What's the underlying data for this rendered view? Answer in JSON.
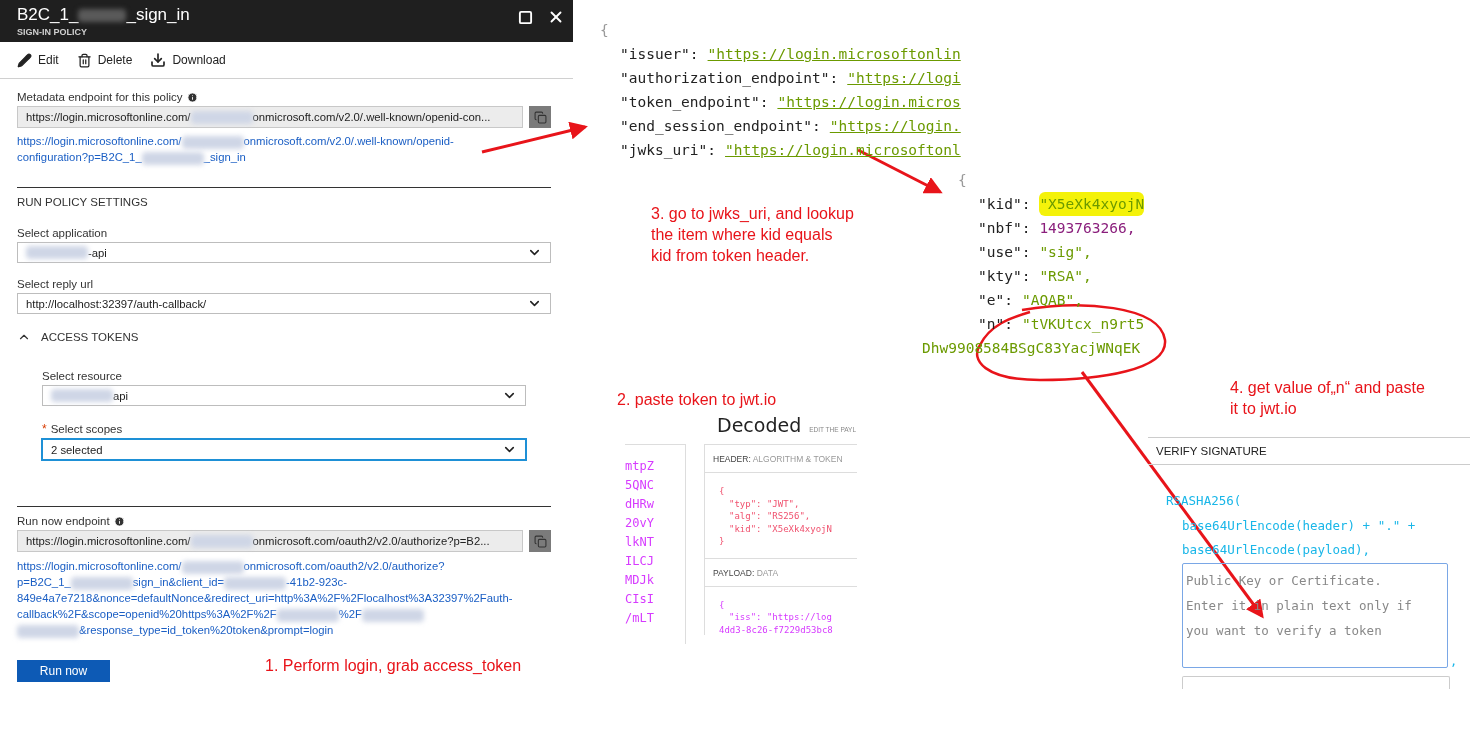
{
  "policy_blade": {
    "title": [
      {
        "kind": "text",
        "text": "B2C_1_"
      },
      {
        "kind": "redacted"
      },
      {
        "kind": "text",
        "text": "_sign_in"
      }
    ],
    "subtitle": "SIGN-IN POLICY",
    "toolbar": [
      {
        "kind": "edit",
        "label": "Edit"
      },
      {
        "kind": "delete",
        "label": "Delete"
      },
      {
        "kind": "download",
        "label": "Download"
      }
    ],
    "metadata": {
      "label": "Metadata endpoint for this policy",
      "value": [
        {
          "kind": "text",
          "text": "https://login.microsoftonline.com/"
        },
        {
          "kind": "redacted"
        },
        {
          "kind": "text",
          "text": "onmicrosoft.com/v2.0/.well-known/openid-con..."
        }
      ],
      "link_lines": [
        [
          {
            "kind": "text",
            "text": "https://login.microsoftonline.com/"
          },
          {
            "kind": "redacted"
          },
          {
            "kind": "text",
            "text": "onmicrosoft.com/v2.0/.well-known/openid-"
          }
        ],
        [
          {
            "kind": "text",
            "text": "configuration?p=B2C_1_"
          },
          {
            "kind": "redacted"
          },
          {
            "kind": "text",
            "text": "_sign_in"
          }
        ]
      ]
    },
    "run_policy_settings": {
      "heading": "RUN POLICY SETTINGS",
      "application": {
        "label": "Select application",
        "value": [
          {
            "kind": "redacted"
          },
          {
            "kind": "text",
            "text": "-api"
          }
        ]
      },
      "reply_url": {
        "label": "Select reply url",
        "value": [
          {
            "kind": "text",
            "text": "http://localhost:32397/auth-callback/"
          }
        ]
      },
      "access_tokens": {
        "heading": "ACCESS TOKENS",
        "expanded": true,
        "resource": {
          "label": "Select resource",
          "required": false,
          "focused": false,
          "value": [
            {
              "kind": "redacted"
            },
            {
              "kind": "text",
              "text": "api"
            }
          ]
        },
        "required_symbol": "*",
        "scopes": {
          "label": "Select scopes",
          "required": true,
          "focused": true,
          "value": [
            {
              "kind": "text",
              "text": "2 selected"
            }
          ]
        }
      }
    },
    "run_now": {
      "label": "Run now endpoint",
      "value": [
        {
          "kind": "text",
          "text": "https://login.microsoftonline.com/"
        },
        {
          "kind": "redacted"
        },
        {
          "kind": "text",
          "text": "onmicrosoft.com/oauth2/v2.0/authorize?p=B2..."
        }
      ],
      "link_lines": [
        [
          {
            "kind": "text",
            "text": "https://login.microsoftonline.com/"
          },
          {
            "kind": "redacted"
          },
          {
            "kind": "text",
            "text": "onmicrosoft.com/oauth2/v2.0/authorize?"
          }
        ],
        [
          {
            "kind": "text",
            "text": "p=B2C_1_"
          },
          {
            "kind": "redacted"
          },
          {
            "kind": "text",
            "text": "sign_in&client_id="
          },
          {
            "kind": "redacted"
          },
          {
            "kind": "text",
            "text": "-41b2-923c-"
          }
        ],
        [
          {
            "kind": "text",
            "text": "849e4a7e7218&nonce=defaultNonce&redirect_uri=http%3A%2F%2Flocalhost%3A32397%2Fauth-"
          }
        ],
        [
          {
            "kind": "text",
            "text": "callback%2F&scope=openid%20https%3A%2F%2F"
          },
          {
            "kind": "redacted"
          },
          {
            "kind": "text",
            "text": "%2F"
          },
          {
            "kind": "redacted"
          }
        ],
        [
          {
            "kind": "redacted"
          },
          {
            "kind": "text",
            "text": "&response_type=id_token%20token&prompt=login"
          }
        ]
      ],
      "button": "Run now"
    }
  },
  "openid_config": {
    "open_brace": "{",
    "lines": [
      {
        "key": "\"issuer\":",
        "value": "\"https://login.microsoftonlin"
      },
      {
        "key": "\"authorization_endpoint\":",
        "value": "\"https://logi"
      },
      {
        "key": "\"token_endpoint\":",
        "value": "\"https://login.micros"
      },
      {
        "key": "\"end_session_endpoint\":",
        "value": "\"https://login."
      },
      {
        "key": "\"jwks_uri\":",
        "value": "\"https://login.microsoftonl"
      }
    ]
  },
  "jwks_key": {
    "open_brace": "{",
    "lines": [
      {
        "key": "\"kid\":",
        "value": "\"X5eXk4xyojN",
        "kind": "string",
        "highlighted": true
      },
      {
        "key": "\"nbf\":",
        "value": "1493763266,",
        "kind": "number",
        "highlighted": false
      },
      {
        "key": "\"use\":",
        "value": "\"sig\",",
        "kind": "string",
        "highlighted": false
      },
      {
        "key": "\"kty\":",
        "value": "\"RSA\",",
        "kind": "string",
        "highlighted": false
      },
      {
        "key": "\"e\":",
        "value": "\"AQAB\",",
        "kind": "string",
        "highlighted": false
      },
      {
        "key": "\"n\":",
        "value": "\"tVKUtcx_n9rt5",
        "kind": "string",
        "highlighted": false
      }
    ],
    "continuation": "Dhw9908584BSgC83YacjWNqEK"
  },
  "jwt_decoded": {
    "title": "Decoded",
    "subtitle": "EDIT THE PAYL",
    "token_lines": [
      "mtpZ",
      "5QNC",
      "dHRw",
      "20vY",
      "lkNT",
      "ILCJ",
      "MDJk",
      "CIsI",
      "/mLT"
    ],
    "header": {
      "label": "HEADER:",
      "detail": "ALGORITHM & TOKEN",
      "lines": [
        "{",
        "\"typ\": \"JWT\",",
        "\"alg\": \"RS256\",",
        "\"kid\": \"X5eXk4xyojN",
        "}"
      ]
    },
    "payload": {
      "label": "PAYLOAD:",
      "detail": "DATA",
      "lines": [
        "{",
        "\"iss\": \"https://log",
        "4dd3-8c26-f7229d53bc8"
      ]
    }
  },
  "verify_signature": {
    "heading": "VERIFY SIGNATURE",
    "code": [
      "RSASHA256(",
      "base64UrlEncode(header) + \".\" +",
      "base64UrlEncode(payload),"
    ],
    "key_placeholder": "Public Key or Certificate. Enter it in plain text only if you want to verify a token",
    "separator": ","
  },
  "annotations": [
    {
      "kind": "step3",
      "lines": [
        "3. go to jwks_uri, and lookup",
        "the item where kid equals",
        "kid from token header."
      ]
    },
    {
      "kind": "step2",
      "lines": [
        "2. paste token to jwt.io"
      ]
    },
    {
      "kind": "step4",
      "lines": [
        "4. get value of„n“ and paste",
        "it to jwt.io"
      ]
    },
    {
      "kind": "step1",
      "lines": [
        "1. Perform login, grab access_token"
      ]
    }
  ]
}
